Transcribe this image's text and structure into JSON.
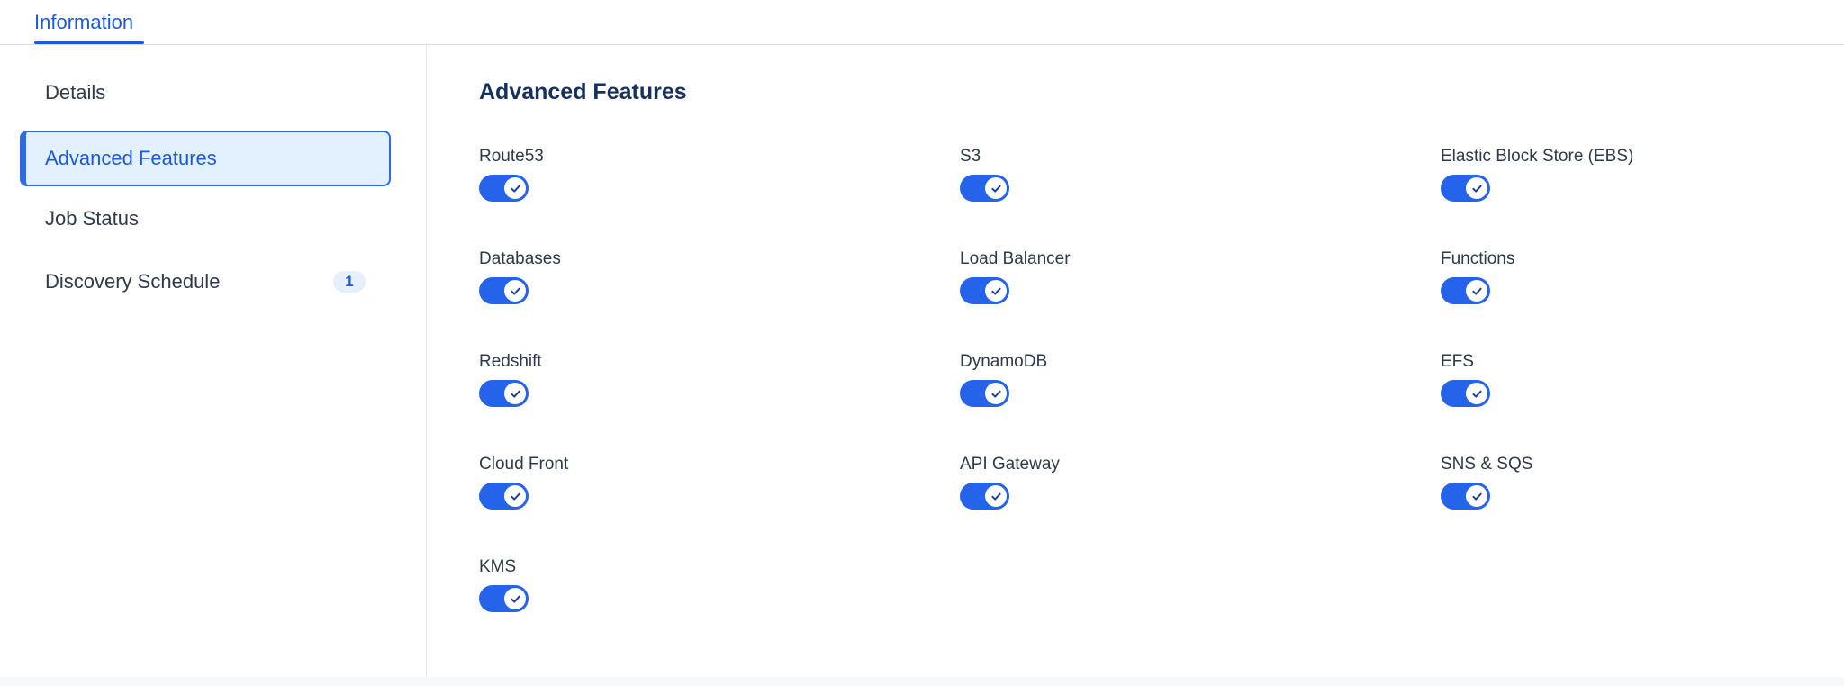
{
  "tabs": [
    {
      "label": "Information"
    }
  ],
  "sidebar": {
    "items": [
      {
        "label": "Details"
      },
      {
        "label": "Advanced Features",
        "active": true
      },
      {
        "label": "Job Status"
      },
      {
        "label": "Discovery Schedule",
        "badge": "1"
      }
    ]
  },
  "main": {
    "title": "Advanced Features",
    "features": [
      {
        "label": "Route53",
        "enabled": true
      },
      {
        "label": "S3",
        "enabled": true
      },
      {
        "label": "Elastic Block Store (EBS)",
        "enabled": true
      },
      {
        "label": "Databases",
        "enabled": true
      },
      {
        "label": "Load Balancer",
        "enabled": true
      },
      {
        "label": "Functions",
        "enabled": true
      },
      {
        "label": "Redshift",
        "enabled": true
      },
      {
        "label": "DynamoDB",
        "enabled": true
      },
      {
        "label": "EFS",
        "enabled": true
      },
      {
        "label": "Cloud Front",
        "enabled": true
      },
      {
        "label": "API Gateway",
        "enabled": true
      },
      {
        "label": "SNS & SQS",
        "enabled": true
      },
      {
        "label": "KMS",
        "enabled": true
      }
    ]
  },
  "colors": {
    "accent": "#1d5bd6",
    "toggle_on": "#2563eb",
    "active_bg": "#e3f0fd"
  },
  "icons": {
    "toggle_knob": "check-icon"
  }
}
